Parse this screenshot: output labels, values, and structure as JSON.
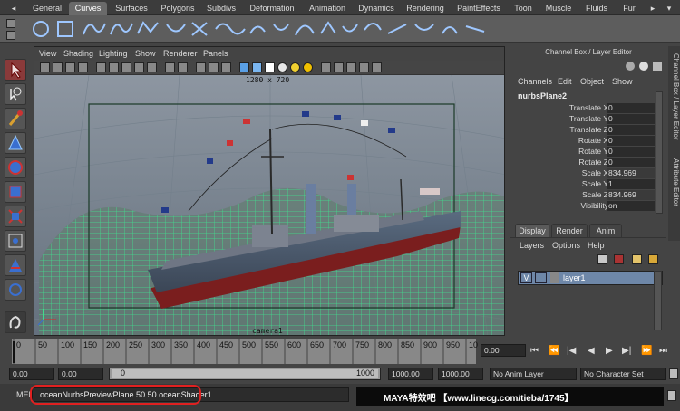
{
  "shelf": {
    "tabs": [
      "General",
      "Curves",
      "Surfaces",
      "Polygons",
      "Subdivs",
      "Deformation",
      "Animation",
      "Dynamics",
      "Rendering",
      "PaintEffects",
      "Toon",
      "Muscle",
      "Fluids",
      "Fur"
    ],
    "active_tab": "Curves"
  },
  "viewport": {
    "menu": [
      "View",
      "Shading",
      "Lighting",
      "Show",
      "Renderer",
      "Panels"
    ],
    "resolution": "1280 x 720",
    "camera": "camera1"
  },
  "channel_box": {
    "title": "Channel Box / Layer Editor",
    "menu": [
      "Channels",
      "Edit",
      "Object",
      "Show"
    ],
    "object_name": "nurbsPlane2",
    "attributes": [
      {
        "label": "Translate X",
        "value": "0"
      },
      {
        "label": "Translate Y",
        "value": "0"
      },
      {
        "label": "Translate Z",
        "value": "0"
      },
      {
        "label": "Rotate X",
        "value": "0"
      },
      {
        "label": "Rotate Y",
        "value": "0"
      },
      {
        "label": "Rotate Z",
        "value": "0"
      },
      {
        "label": "Scale X",
        "value": "834.969"
      },
      {
        "label": "Scale Y",
        "value": "1"
      },
      {
        "label": "Scale Z",
        "value": "834.969"
      },
      {
        "label": "Visibility",
        "value": "on"
      }
    ],
    "side_tabs": [
      "Channel Box / Layer Editor",
      "Attribute Editor"
    ]
  },
  "layer_editor": {
    "tabs": [
      "Display",
      "Render",
      "Anim"
    ],
    "active_tab": "Display",
    "menu": [
      "Layers",
      "Options",
      "Help"
    ],
    "layer": {
      "visible": "V",
      "name": "layer1"
    }
  },
  "timeline": {
    "ticks": [
      "0",
      "50",
      "100",
      "150",
      "200",
      "250",
      "300",
      "350",
      "400",
      "450",
      "500",
      "550",
      "600",
      "650",
      "700",
      "750",
      "800",
      "850",
      "900",
      "950",
      "10"
    ],
    "current_frame": "0.00"
  },
  "range": {
    "start": "0.00",
    "playback_start": "0.00",
    "slider_left": "0",
    "slider_right": "1000",
    "playback_end": "1000.00",
    "end": "1000.00",
    "anim_layer": "No Anim Layer",
    "character_set": "No Character Set"
  },
  "command_line": {
    "label": "MEL",
    "text": "oceanNurbsPreviewPlane 50 50 oceanShader1",
    "watermark": "MAYA特效吧 【www.linecg.com/tieba/1745】"
  },
  "colors": {
    "ocean_wire": "#3fe28f",
    "highlight": "#e02020",
    "selection_frame": "#1f5a3a"
  }
}
